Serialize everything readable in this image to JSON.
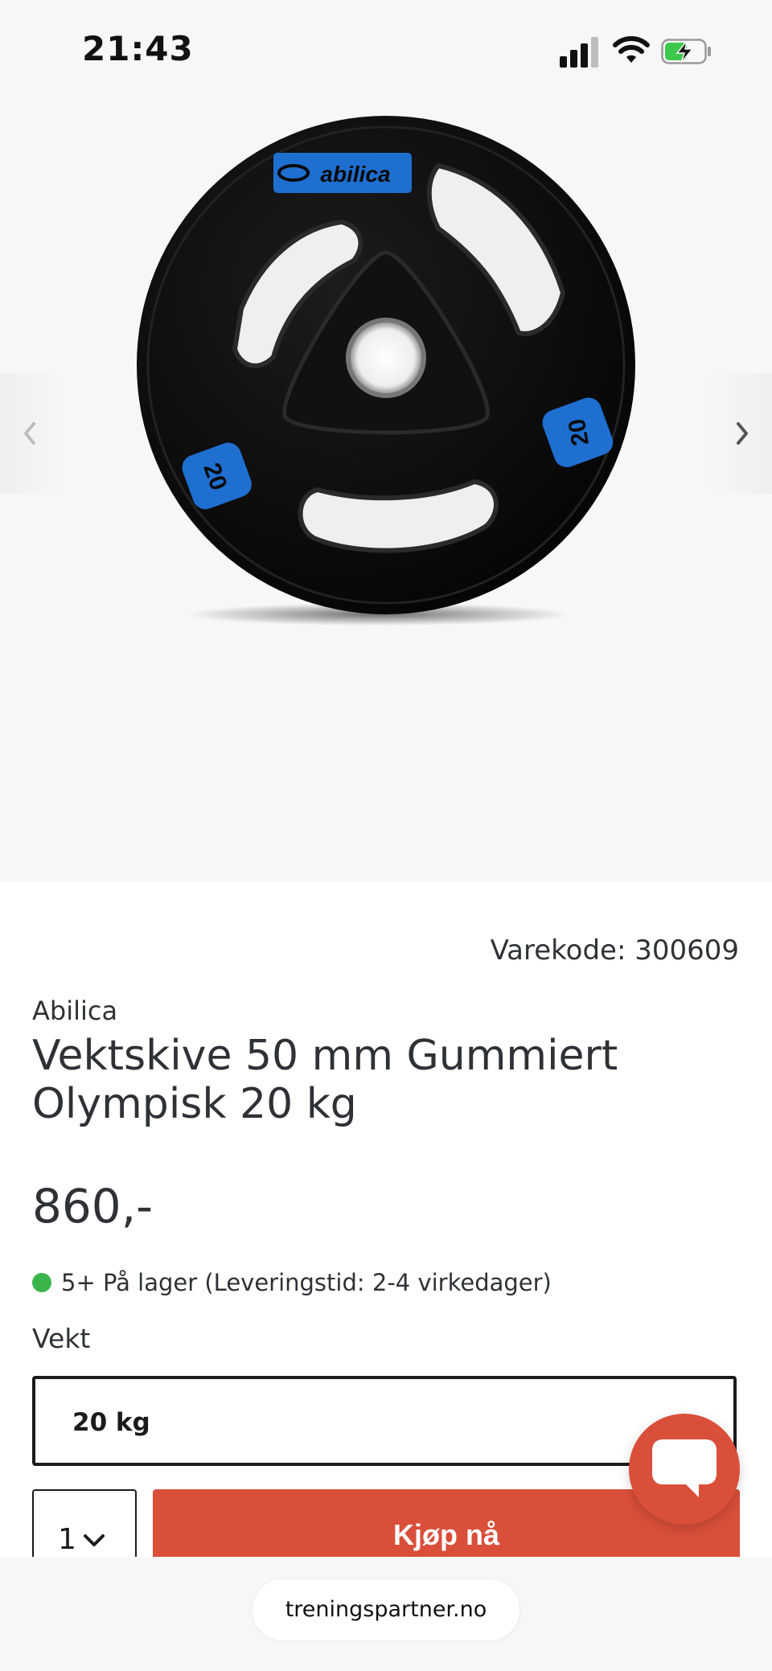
{
  "status_bar": {
    "time": "21:43"
  },
  "product": {
    "sku_label": "Varekode: 300609",
    "brand": "Abilica",
    "title": "Vektskive 50 mm Gummiert Olympisk 20 kg",
    "price": "860,-",
    "stock_text": "5+ På lager (Leveringstid: 2-4 virkedager)",
    "stock_color": "#3bb54a",
    "image": {
      "logo_text": "abilica",
      "weight_marking": "20"
    }
  },
  "variant": {
    "label": "Vekt",
    "selected": "20 kg"
  },
  "purchase": {
    "quantity": "1",
    "buy_label": "Kjøp nå",
    "accent": "#d94f3a"
  },
  "browser": {
    "url": "treningspartner.no"
  }
}
